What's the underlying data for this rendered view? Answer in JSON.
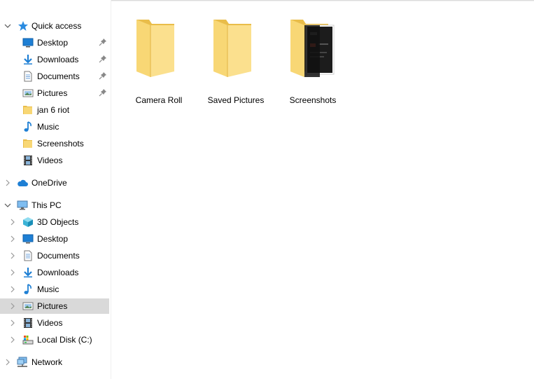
{
  "nav": {
    "quick_access": {
      "label": "Quick access"
    },
    "quick_items": [
      {
        "label": "Desktop",
        "icon": "desktop-icon",
        "pinned": true
      },
      {
        "label": "Downloads",
        "icon": "download-arrow-icon",
        "pinned": true
      },
      {
        "label": "Documents",
        "icon": "document-icon",
        "pinned": true
      },
      {
        "label": "Pictures",
        "icon": "pictures-icon",
        "pinned": true
      },
      {
        "label": "jan 6 riot",
        "icon": "folder-icon",
        "pinned": false
      },
      {
        "label": "Music",
        "icon": "music-note-icon",
        "pinned": false
      },
      {
        "label": "Screenshots",
        "icon": "folder-icon",
        "pinned": false
      },
      {
        "label": "Videos",
        "icon": "film-strip-icon",
        "pinned": false
      }
    ],
    "onedrive": {
      "label": "OneDrive",
      "icon": "cloud-icon"
    },
    "this_pc": {
      "label": "This PC",
      "icon": "monitor-icon"
    },
    "pc_items": [
      {
        "label": "3D Objects",
        "icon": "cube-icon"
      },
      {
        "label": "Desktop",
        "icon": "desktop-icon"
      },
      {
        "label": "Documents",
        "icon": "document-icon"
      },
      {
        "label": "Downloads",
        "icon": "download-arrow-icon"
      },
      {
        "label": "Music",
        "icon": "music-note-icon"
      },
      {
        "label": "Pictures",
        "icon": "pictures-icon",
        "selected": true
      },
      {
        "label": "Videos",
        "icon": "film-strip-icon"
      },
      {
        "label": "Local Disk (C:)",
        "icon": "disk-drive-icon"
      }
    ],
    "network": {
      "label": "Network",
      "icon": "network-icon"
    }
  },
  "folders": [
    {
      "name": "Camera Roll",
      "icon": "folder-icon"
    },
    {
      "name": "Saved Pictures",
      "icon": "folder-icon"
    },
    {
      "name": "Screenshots",
      "icon": "folder-with-preview-icon"
    }
  ],
  "colors": {
    "folder": "#f8d775",
    "folder_dark": "#e9bd4a",
    "accent_blue": "#1e7fd4",
    "selected_row": "#d9d9d9"
  }
}
